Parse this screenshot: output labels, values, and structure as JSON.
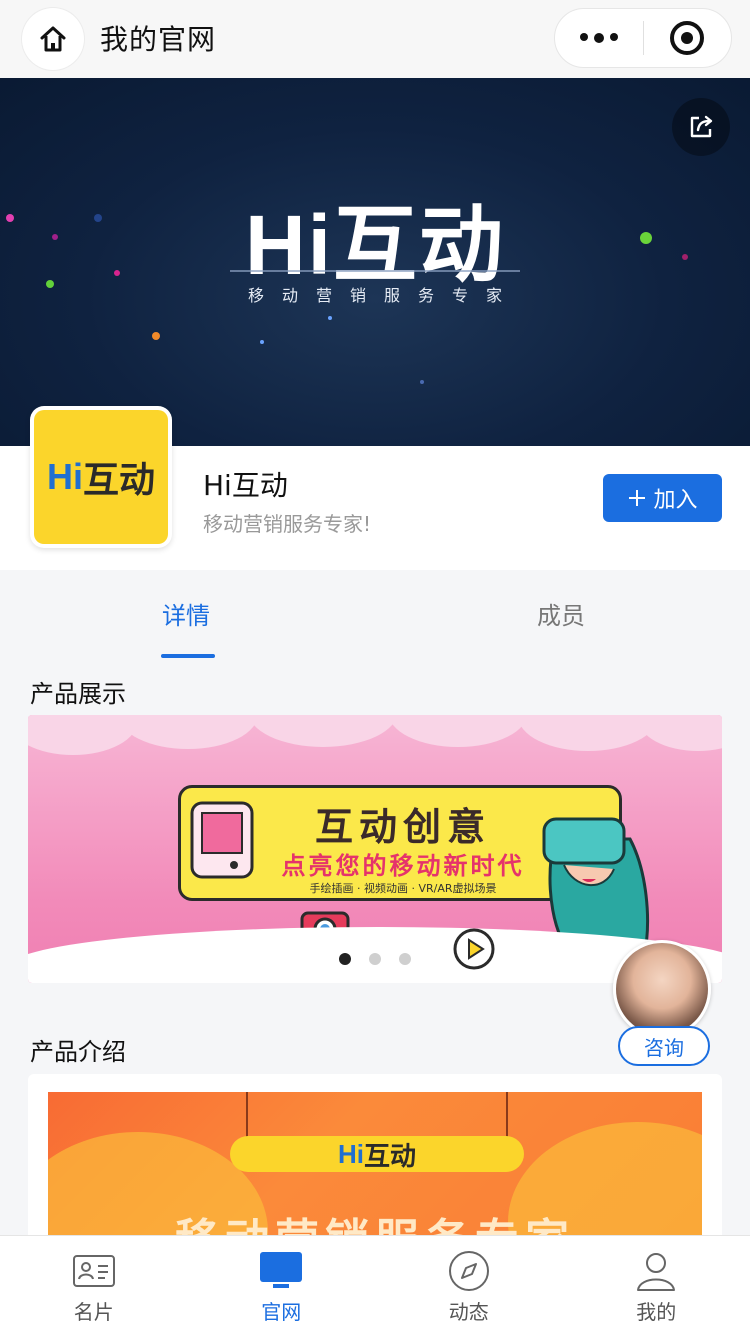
{
  "nav": {
    "title": "我的官网",
    "home_icon": "home-icon",
    "more_icon": "more-dots-icon",
    "close_icon": "target-circle-icon"
  },
  "banner": {
    "logo_text": "Hi互动",
    "slogan": "移动营销服务专家",
    "share_icon": "share-icon"
  },
  "profile": {
    "logo_hi": "Hi",
    "logo_cn": "互动",
    "name": "Hi互动",
    "description": "移动营销服务专家!",
    "join_label": "加入"
  },
  "tabs": [
    {
      "label": "详情",
      "active": true
    },
    {
      "label": "成员",
      "active": false
    }
  ],
  "sections": {
    "showcase_title": "产品展示",
    "intro_title": "产品介绍"
  },
  "carousel": {
    "headline": "互动创意",
    "subline": "点亮您的移动新时代",
    "tags": "手绘插画 · 视频动画 · VR/AR虚拟场景",
    "slide_count": 3,
    "active_index": 0
  },
  "consult": {
    "label": "咨询"
  },
  "intro": {
    "plaque_hi": "Hi",
    "plaque_cn": "互动",
    "slogan": "移动营销服务专家"
  },
  "tabbar": [
    {
      "label": "名片",
      "icon": "card-icon",
      "active": false
    },
    {
      "label": "官网",
      "icon": "monitor-icon",
      "active": true
    },
    {
      "label": "动态",
      "icon": "compass-icon",
      "active": false
    },
    {
      "label": "我的",
      "icon": "user-icon",
      "active": false
    }
  ],
  "colors": {
    "accent": "#1b6ee0",
    "brand_yellow": "#fbd52b",
    "banner_bg": "#0f2240"
  }
}
